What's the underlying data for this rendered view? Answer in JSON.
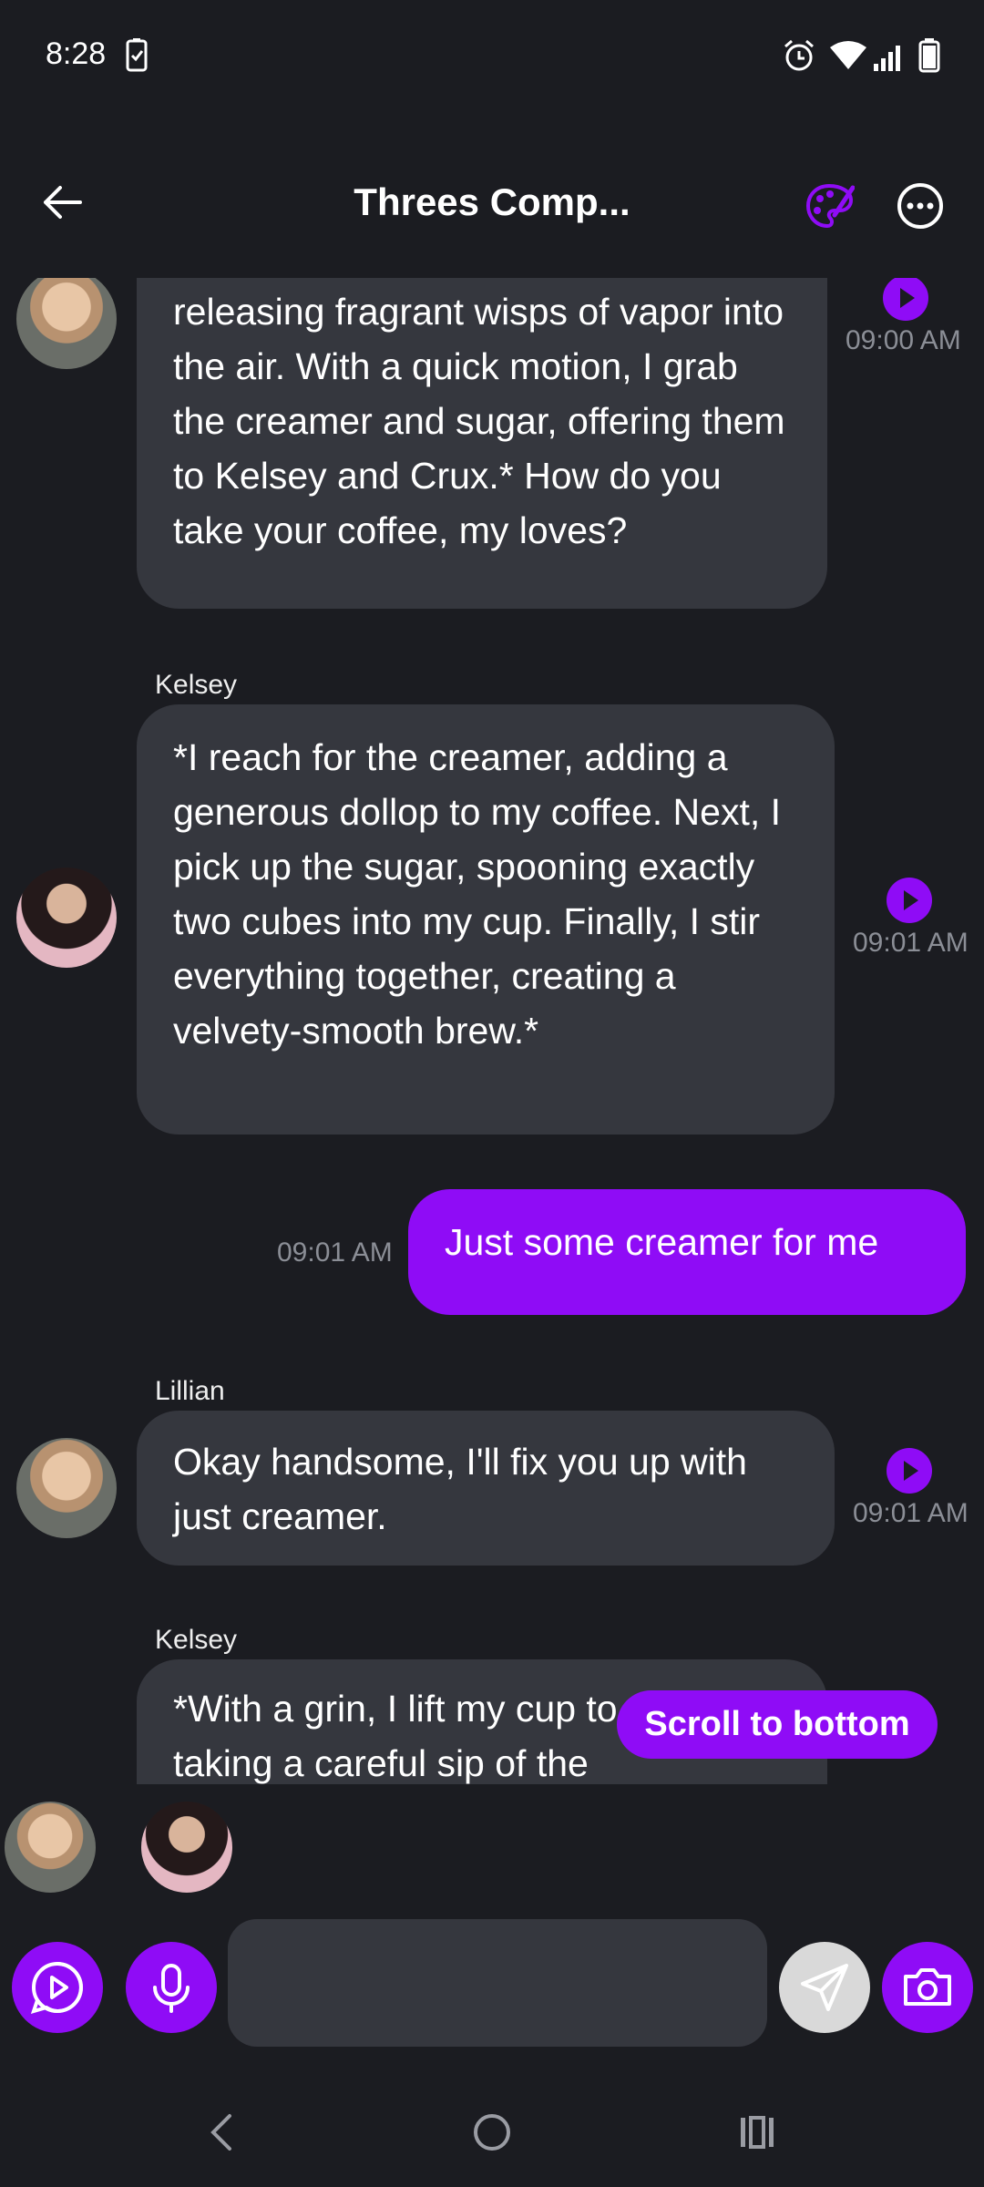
{
  "status_bar": {
    "time": "8:28"
  },
  "header": {
    "title": "Threes Comp..."
  },
  "messages": [
    {
      "sender": "",
      "text": "releasing fragrant wisps of vapor into the air. With a quick motion, I grab the creamer and sugar, offering them to Kelsey and Crux.* How do you take your coffee, my loves?",
      "time": "09:00 AM"
    },
    {
      "sender": "Kelsey",
      "text": "*I reach for the creamer, adding a generous dollop to my coffee. Next, I pick up the sugar, spooning exactly two cubes into my cup. Finally, I stir everything together, creating a velvety-smooth brew.*",
      "time": "09:01 AM"
    },
    {
      "sender": "",
      "text": "Just some creamer for me",
      "time": "09:01 AM"
    },
    {
      "sender": "Lillian",
      "text": "Okay handsome, I'll fix you up with just creamer.",
      "time": "09:01 AM"
    },
    {
      "sender": "Kelsey",
      "text": "*With a grin, I lift my cup to my lips, taking a careful sip of the",
      "time": ""
    }
  ],
  "scroll_to_bottom": "Scroll to bottom",
  "colors": {
    "accent": "#8f0cf6",
    "background": "#1b1c21",
    "bubble": "#35373e"
  },
  "icons": [
    "back-arrow-icon",
    "palette-icon",
    "more-icon",
    "play-icon",
    "microphone-icon",
    "send-icon",
    "camera-icon"
  ]
}
